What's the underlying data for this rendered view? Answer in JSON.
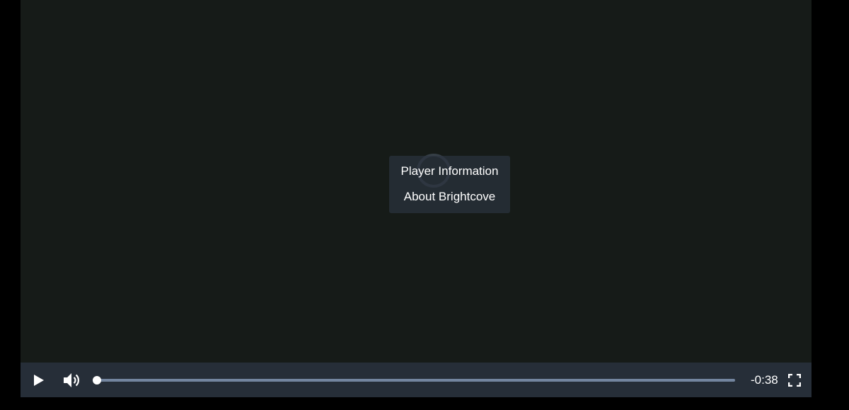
{
  "context_menu": {
    "items": [
      {
        "label": "Player Information"
      },
      {
        "label": "About Brightcove"
      }
    ]
  },
  "controls": {
    "play_icon": "play-icon",
    "volume_icon": "volume-icon",
    "fullscreen_icon": "fullscreen-icon",
    "remaining_time": "-0:38",
    "progress_percent": 0
  },
  "colors": {
    "video_background": "#161b18",
    "control_bar": "#262e38",
    "progress_track": "#73859f",
    "foreground": "#ffffff"
  }
}
